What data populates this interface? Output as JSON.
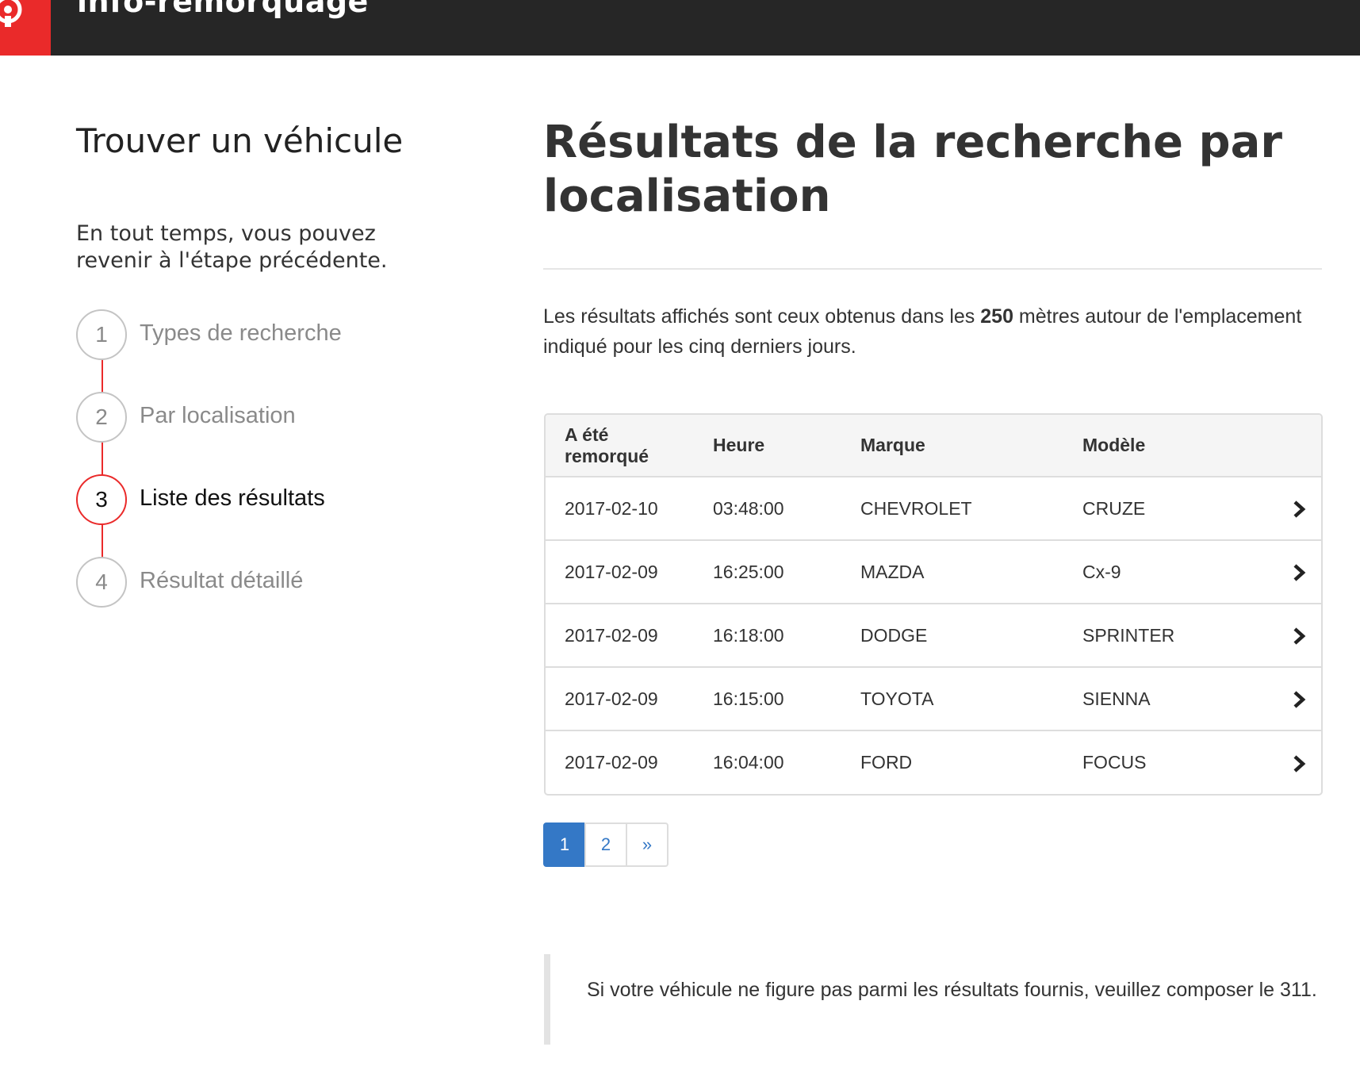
{
  "header": {
    "title": "info-remorquage",
    "logo_icon": "brand-logo-icon",
    "brand_color": "#ea2a2a"
  },
  "sidebar": {
    "title": "Trouver un véhicule",
    "subtitle": "En tout temps, vous pouvez revenir à l'étape précédente.",
    "steps": [
      {
        "number": "1",
        "label": "Types de recherche",
        "state": "completed"
      },
      {
        "number": "2",
        "label": "Par localisation",
        "state": "completed"
      },
      {
        "number": "3",
        "label": "Liste des résultats",
        "state": "active"
      },
      {
        "number": "4",
        "label": "Résultat détaillé",
        "state": "upcoming"
      }
    ]
  },
  "main": {
    "title": "Résultats de la recherche par localisation",
    "intro_before": "Les résultats affichés sont ceux obtenus dans les ",
    "intro_bold": "250",
    "intro_after": " mètres autour de l'emplacement indiqué pour les cinq derniers jours.",
    "table": {
      "headers": [
        "A été remorqué",
        "Heure",
        "Marque",
        "Modèle"
      ],
      "rows": [
        [
          "2017-02-10",
          "03:48:00",
          "CHEVROLET",
          "CRUZE"
        ],
        [
          "2017-02-09",
          "16:25:00",
          "MAZDA",
          "Cx-9"
        ],
        [
          "2017-02-09",
          "16:18:00",
          "DODGE",
          "SPRINTER"
        ],
        [
          "2017-02-09",
          "16:15:00",
          "TOYOTA",
          "SIENNA"
        ],
        [
          "2017-02-09",
          "16:04:00",
          "FORD",
          "FOCUS"
        ]
      ],
      "row_icon": "chevron-right-icon"
    },
    "pagination": {
      "pages": [
        "1",
        "2"
      ],
      "current": "1",
      "next_label": "»"
    },
    "note": "Si votre véhicule ne figure pas parmi les résultats fournis, veuillez composer le 311."
  },
  "colors": {
    "header_bg": "#262626",
    "accent_red": "#ea2a2a",
    "link_blue": "#3478c6"
  }
}
